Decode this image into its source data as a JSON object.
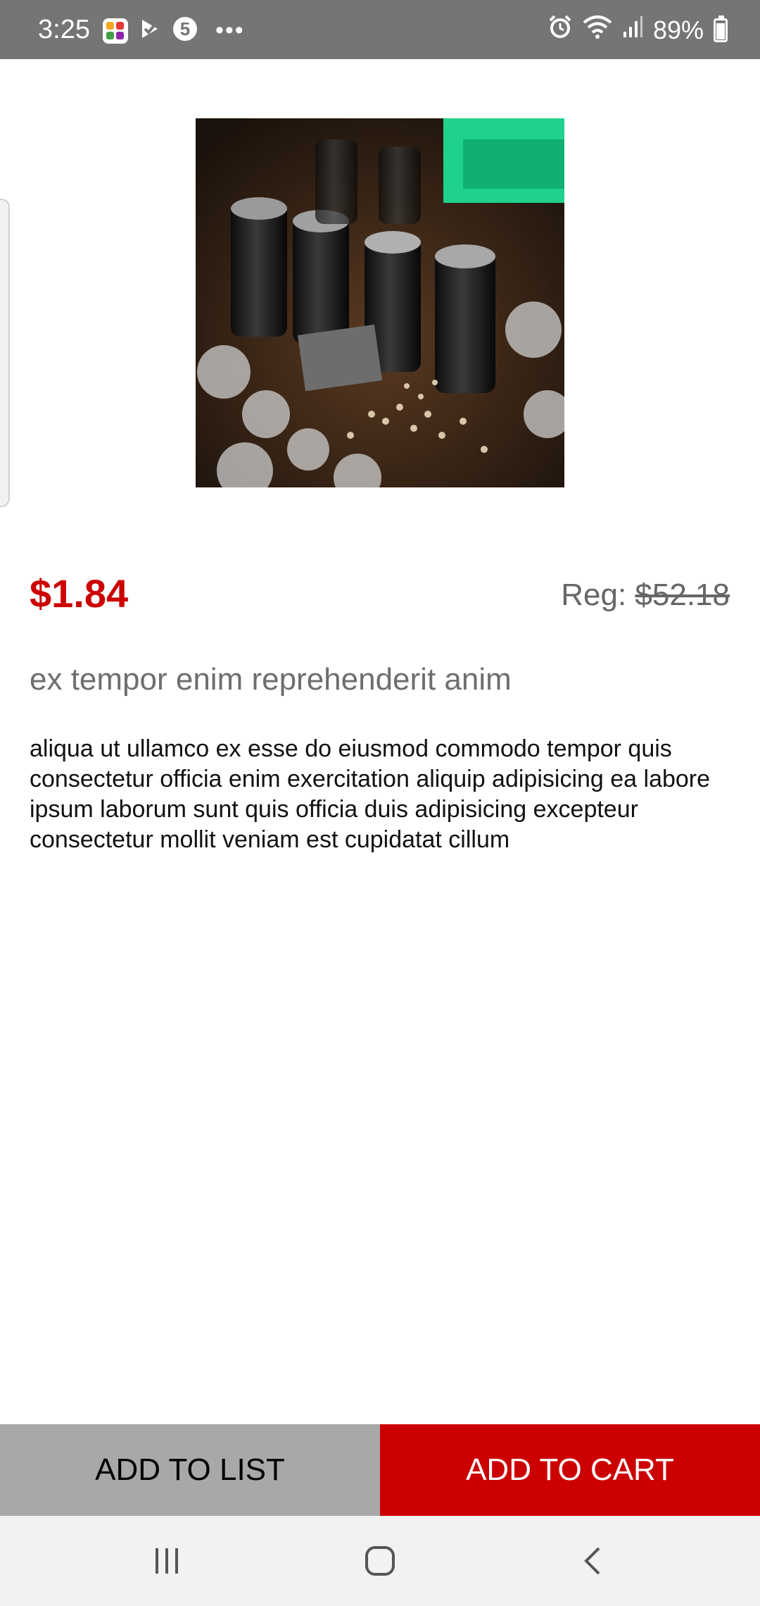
{
  "status_bar": {
    "time": "3:25",
    "battery": "89%",
    "left_icons": [
      "multi-app-icon",
      "play-check-icon",
      "five-badge-icon",
      "more-dots-icon"
    ],
    "right_icons": [
      "alarm-icon",
      "wifi-icon",
      "signal-icon",
      "battery-charging-icon"
    ]
  },
  "product": {
    "image_icon": "circuit-board-capacitors-photo",
    "sale_price": "$1.84",
    "regular_label": "Reg:",
    "regular_price": "$52.18",
    "title": "ex tempor enim reprehenderit anim",
    "description": "aliqua ut ullamco ex esse do eiusmod commodo tempor quis consectetur officia enim exercitation aliquip adipisicing ea labore ipsum laborum sunt quis officia duis adipisicing excepteur consectetur mollit veniam est cupidatat cillum"
  },
  "actions": {
    "add_to_list": "ADD TO LIST",
    "add_to_cart": "ADD TO CART"
  },
  "colors": {
    "accent_red": "#cc0000",
    "list_button_gray": "#a8a8a8",
    "status_bar_gray": "#757575"
  },
  "nav": [
    "recent-apps-icon",
    "home-icon",
    "back-icon"
  ]
}
